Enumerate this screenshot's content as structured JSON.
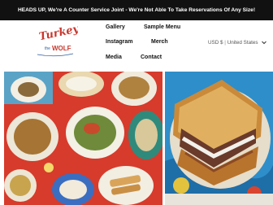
{
  "announcement": {
    "text": "HEADS UP, We're A Counter Service Joint - We're Not Able To Take Reservations Of Any Size!"
  },
  "logo": {
    "line1": "Turkey",
    "line2": "WOLF",
    "connector": "the"
  },
  "nav": {
    "gallery": "Gallery",
    "sample_menu": "Sample Menu",
    "instagram": "Instagram",
    "merch": "Merch",
    "media": "Media",
    "contact": "Contact"
  },
  "currency": {
    "code": "USD $",
    "separator": "|",
    "country": "United States"
  },
  "images": {
    "left": "table-of-dishes-photo",
    "right": "grilled-sandwich-photo"
  },
  "colors": {
    "announcement_bg": "#111111",
    "logo_red": "#c8372d",
    "logo_blue": "#2d5c9c"
  }
}
